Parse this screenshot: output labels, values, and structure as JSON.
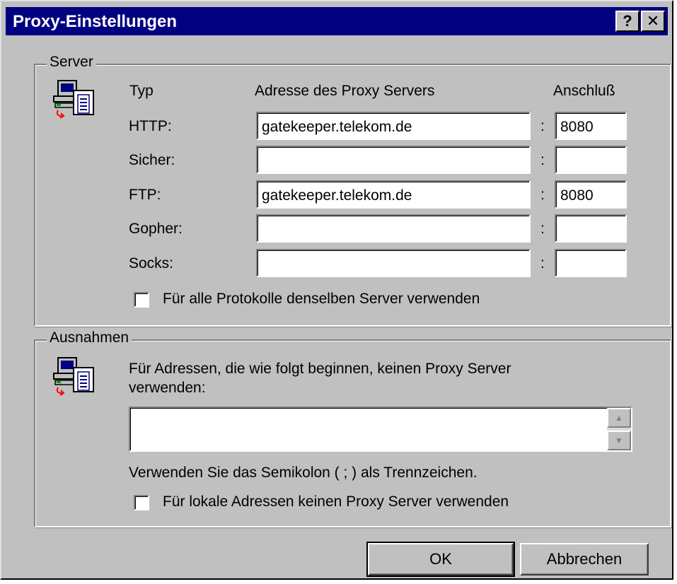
{
  "window": {
    "title": "Proxy-Einstellungen",
    "help_label": "?",
    "close_label": "✕"
  },
  "server": {
    "group_label": "Server",
    "header_type": "Typ",
    "header_address": "Adresse des Proxy Servers",
    "header_port": "Anschluß",
    "rows": [
      {
        "label": "HTTP:",
        "address": "gatekeeper.telekom.de",
        "port": "8080"
      },
      {
        "label": "Sicher:",
        "address": "",
        "port": ""
      },
      {
        "label": "FTP:",
        "address": "gatekeeper.telekom.de",
        "port": "8080"
      },
      {
        "label": "Gopher:",
        "address": "",
        "port": ""
      },
      {
        "label": "Socks:",
        "address": "",
        "port": ""
      }
    ],
    "colon": ":",
    "same_server_label": "Für alle Protokolle denselben Server verwenden",
    "same_server_checked": false
  },
  "exceptions": {
    "group_label": "Ausnahmen",
    "description": "Für Adressen, die wie folgt beginnen, keinen Proxy Server",
    "description_line2": "verwenden:",
    "value": "",
    "hint": "Verwenden Sie das Semikolon ( ; ) als Trennzeichen.",
    "local_label": "Für lokale Adressen keinen Proxy Server verwenden",
    "local_checked": false
  },
  "buttons": {
    "ok": "OK",
    "cancel": "Abbrechen"
  },
  "icons": {
    "server_icon": "network-computer-icon",
    "exceptions_icon": "network-computer-icon"
  }
}
